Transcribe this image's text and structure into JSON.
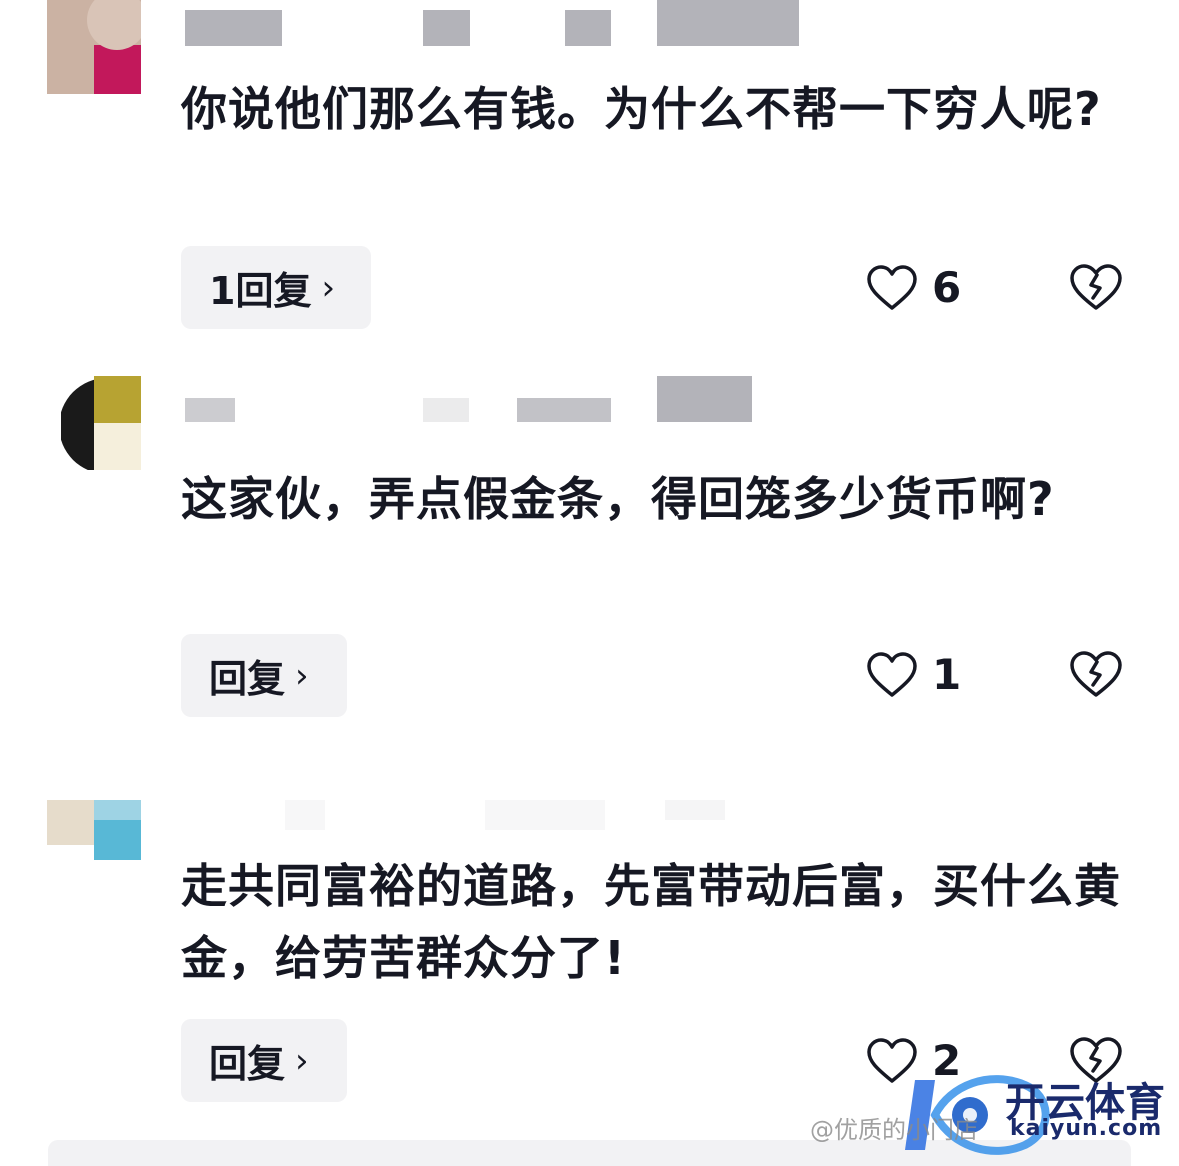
{
  "comments": [
    {
      "text": "你说他们那么有钱。为什么不帮一下穷人呢?",
      "reply_label": "1回复",
      "chevron": "›",
      "likes": "6"
    },
    {
      "text": "这家伙，弄点假金条，得回笼多少货币啊?",
      "reply_label": "回复",
      "chevron": "›",
      "likes": "1"
    },
    {
      "text": "走共同富裕的道路，先富带动后富，买什么黄金，给劳苦群众分了!",
      "reply_label": "回复",
      "chevron": "›",
      "likes": "2"
    }
  ],
  "icons": {
    "like": "heart-outline-icon",
    "dislike": "broken-heart-icon"
  },
  "watermark": {
    "brand": "开云体育",
    "url": "kaiyun.com",
    "credit": "@优质的小门店"
  },
  "colors": {
    "text": "#161823",
    "button_bg": "#f2f2f4"
  }
}
